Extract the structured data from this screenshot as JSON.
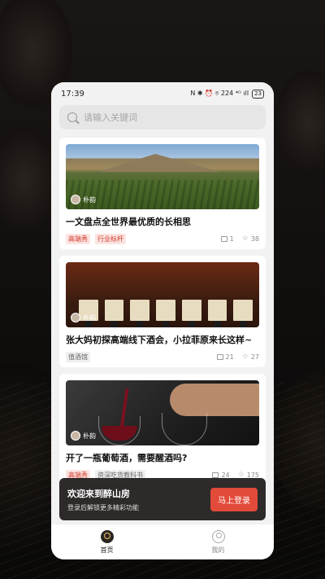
{
  "status_bar": {
    "time": "17:39",
    "icons": "N ✱ ⏰ ⌾ 224 ⁴ᴳ ıll",
    "battery": "23"
  },
  "search": {
    "placeholder": "请输入关键词"
  },
  "articles": [
    {
      "author": "朴韵",
      "title": "一文盘点全世界最优质的长相思",
      "tags": [
        "高端秀",
        "行业标杆"
      ],
      "comments": "1",
      "favorites": "38"
    },
    {
      "author": "朴韵",
      "title": "张大妈初探高端线下酒会，小拉菲原来长这样~",
      "tags": [
        "值酒馆"
      ],
      "comments": "21",
      "favorites": "27"
    },
    {
      "author": "朴韵",
      "title": "开了一瓶葡萄酒，需要醒酒吗?",
      "tags": [
        "高端秀",
        "资深吃货教科书"
      ],
      "comments": "24",
      "favorites": "175"
    }
  ],
  "login_banner": {
    "title": "欢迎来到醉山房",
    "subtitle": "登录后解锁更多精彩功能",
    "button": "马上登录"
  },
  "tabbar": {
    "home": "首页",
    "mine": "我的"
  },
  "colors": {
    "accent": "#e24a3a",
    "tag_red": "#d23b2a"
  }
}
